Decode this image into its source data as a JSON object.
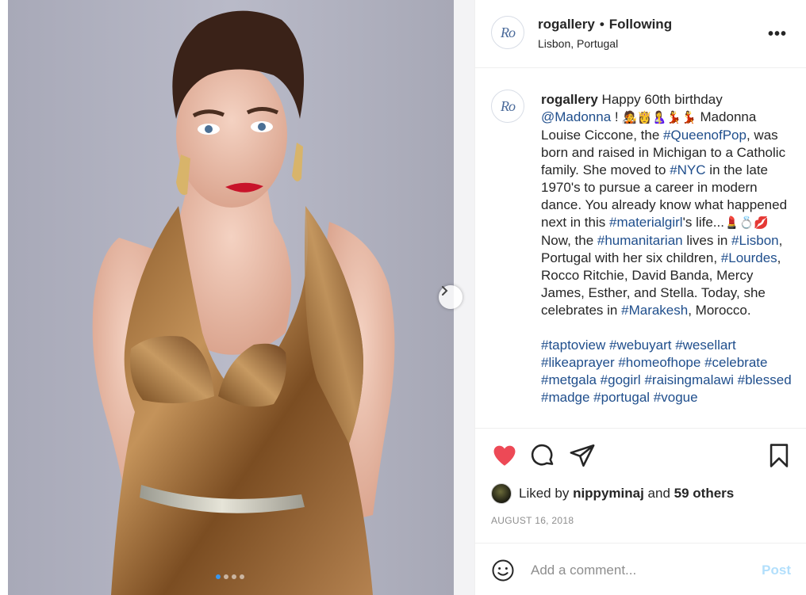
{
  "post": {
    "username": "rogallery",
    "follow_state": "Following",
    "separator": "•",
    "location": "Lisbon, Portugal",
    "avatar_text": "Ro",
    "more_icon": "more-horizontal-icon",
    "more_glyph": "•••"
  },
  "caption": {
    "username": "rogallery",
    "segments": [
      {
        "t": "text",
        "v": " Happy 60th birthday "
      },
      {
        "t": "tag",
        "v": "@Madonna"
      },
      {
        "t": "text",
        "v": " ! "
      },
      {
        "t": "emoji",
        "v": "🧑‍🎤👸🤱💃💃"
      },
      {
        "t": "text",
        "v": " Madonna Louise Ciccone, the "
      },
      {
        "t": "tag",
        "v": "#QueenofPop"
      },
      {
        "t": "text",
        "v": ", was born and raised in Michigan to a Catholic family. She moved to "
      },
      {
        "t": "tag",
        "v": "#NYC"
      },
      {
        "t": "text",
        "v": " in the late 1970's to pursue a career in modern dance. You already know what happened next in this "
      },
      {
        "t": "tag",
        "v": "#materialgirl"
      },
      {
        "t": "text",
        "v": "'s life..."
      },
      {
        "t": "emoji",
        "v": "💄💍💋"
      },
      {
        "t": "text",
        "v": " Now, the "
      },
      {
        "t": "tag",
        "v": "#humanitarian"
      },
      {
        "t": "text",
        "v": " lives in "
      },
      {
        "t": "tag",
        "v": "#Lisbon"
      },
      {
        "t": "text",
        "v": ", Portugal with her six children, "
      },
      {
        "t": "tag",
        "v": "#Lourdes"
      },
      {
        "t": "text",
        "v": ", Rocco Ritchie, David Banda, Mercy James, Esther, and Stella. Today, she celebrates in "
      },
      {
        "t": "tag",
        "v": "#Marakesh"
      },
      {
        "t": "text",
        "v": ", Morocco."
      }
    ],
    "hashtags": [
      "#taptoview",
      "#webuyart",
      "#wesellart",
      "#likeaprayer",
      "#homeofhope",
      "#celebrate",
      "#metgala",
      "#gogirl",
      "#raisingmalawi",
      "#blessed",
      "#madge",
      "#portugal",
      "#vogue"
    ]
  },
  "actions": {
    "like_icon": "heart-filled-icon",
    "comment_icon": "comment-bubble-icon",
    "share_icon": "paper-plane-icon",
    "save_icon": "bookmark-icon",
    "like_color": "#ed4956"
  },
  "likes": {
    "prefix": "Liked by",
    "user": "nippyminaj",
    "conjunction": "and",
    "others": "59 others"
  },
  "date": "AUGUST 16, 2018",
  "comment": {
    "placeholder": "Add a comment...",
    "post_label": "Post",
    "post_color": "#b2dffc"
  },
  "carousel": {
    "slide_count": 4,
    "active_index": 0,
    "next_icon": "chevron-right-icon"
  },
  "colors": {
    "hashtag": "#1f4e8c",
    "border": "#efefef",
    "muted": "#8e8e8e"
  }
}
